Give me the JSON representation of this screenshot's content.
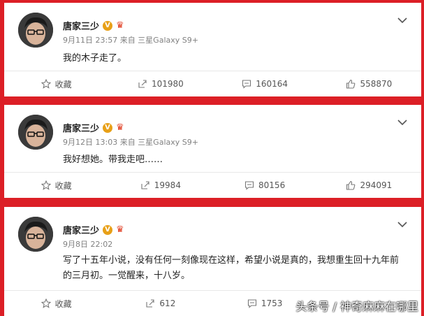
{
  "posts": [
    {
      "author": "唐家三少",
      "verified_badge": "V",
      "meta": "9月11日 23:57 来自 三星Galaxy S9+",
      "content": "我的木子走了。",
      "actions": {
        "favorite": "收藏",
        "repost": "101980",
        "comment": "160164",
        "like": "558870"
      }
    },
    {
      "author": "唐家三少",
      "verified_badge": "V",
      "meta": "9月12日 13:03 来自 三星Galaxy S9+",
      "content": "我好想她。带我走吧……",
      "actions": {
        "favorite": "收藏",
        "repost": "19984",
        "comment": "80156",
        "like": "294091"
      }
    },
    {
      "author": "唐家三少",
      "verified_badge": "V",
      "meta": "9月8日 22:02",
      "content": "写了十五年小说，没有任何一刻像现在这样，希望小说是真的，我想重生回十九年前的三月初。一觉醒来，十八岁。",
      "actions": {
        "favorite": "收藏",
        "repost": "612",
        "comment": "1753",
        "like": ""
      }
    }
  ],
  "watermark": "头条号 / 神奇麻麻在哪里",
  "colors": {
    "background": "#dc1f26",
    "badge": "#e8a017",
    "text": "#222222",
    "meta": "#808080"
  }
}
